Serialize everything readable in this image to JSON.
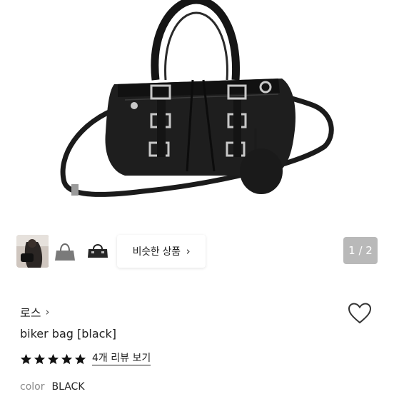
{
  "gallery": {
    "similar_products_label": "비슷한 상품",
    "image_counter": "1 / 2"
  },
  "product": {
    "brand": "로스",
    "name": "biker bag [black]",
    "rating_stars": 5,
    "review_link": "4개 리뷰 보기",
    "color_label": "color",
    "color_value": "BLACK"
  },
  "icons": {
    "heart": "heart-outline-icon",
    "star": "star-filled-icon",
    "chevron": "chevron-right-icon"
  },
  "colors": {
    "counter_bg": "#b9b9b9",
    "text": "#222222",
    "muted": "#888888"
  }
}
